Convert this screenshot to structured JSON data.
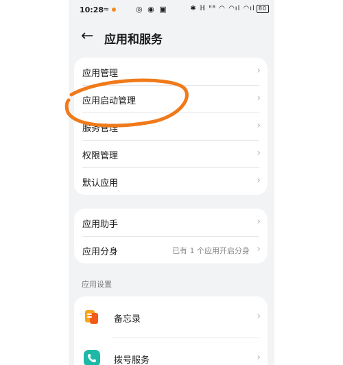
{
  "status_bar": {
    "time": "10:28",
    "left_icons": "≈",
    "mid_icons": "◎ ◉ ▣",
    "right_icons": "✱ ℍ ᴷᴮ ◠ ◠ıl ◠ıl",
    "battery": "80"
  },
  "header": {
    "title": "应用和服务"
  },
  "group1": [
    {
      "label": "应用管理"
    },
    {
      "label": "应用启动管理"
    },
    {
      "label": "服务管理"
    },
    {
      "label": "权限管理"
    },
    {
      "label": "默认应用"
    }
  ],
  "group2": [
    {
      "label": "应用助手",
      "value": ""
    },
    {
      "label": "应用分身",
      "value": "已有 1 个应用开启分身"
    }
  ],
  "section_app_settings": "应用设置",
  "apps": [
    {
      "label": "备忘录",
      "icon": "memo-icon"
    },
    {
      "label": "拨号服务",
      "icon": "phone-dialer-icon"
    }
  ],
  "chevron": "›",
  "back_symbol": "←",
  "colors": {
    "annotation": "#f07a1a",
    "dialer": "#1cb9a7",
    "memo": "#f7a51f"
  }
}
